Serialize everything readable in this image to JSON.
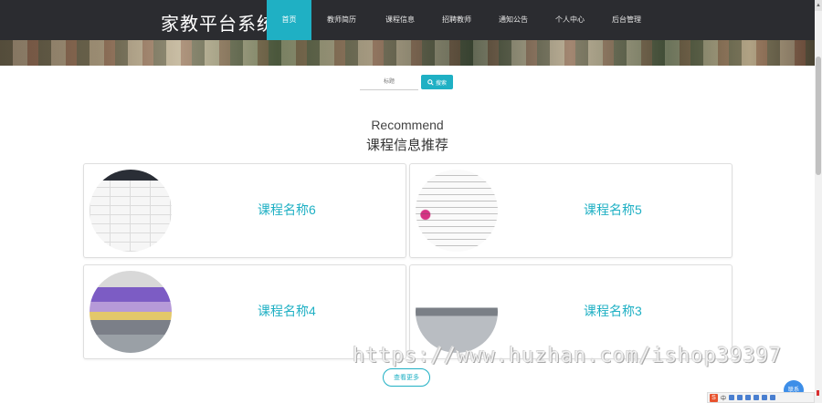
{
  "header": {
    "brand": "家教平台系统",
    "nav_items": [
      {
        "label": "首页",
        "active": true
      },
      {
        "label": "教师简历",
        "active": false
      },
      {
        "label": "课程信息",
        "active": false
      },
      {
        "label": "招聘教师",
        "active": false
      },
      {
        "label": "通知公告",
        "active": false
      },
      {
        "label": "个人中心",
        "active": false
      },
      {
        "label": "后台管理",
        "active": false
      }
    ]
  },
  "search": {
    "placeholder": "标题",
    "button_label": "搜索"
  },
  "section": {
    "title_en": "Recommend",
    "title_cn": "课程信息推荐"
  },
  "cards": [
    {
      "title": "课程名称6",
      "image": "math-function-table-image"
    },
    {
      "title": "课程名称5",
      "image": "mind-map-image"
    },
    {
      "title": "课程名称4",
      "image": "classroom-image"
    },
    {
      "title": "课程名称3",
      "image": "students-studying-image"
    }
  ],
  "more_button": "查看更多",
  "watermark": "https://www.huzhan.com/ishop39397",
  "float_button": "联系",
  "ime": {
    "logo": "S",
    "mode": "中"
  },
  "colors": {
    "accent": "#1fb0c4",
    "nav_bg": "#2b2c30"
  }
}
